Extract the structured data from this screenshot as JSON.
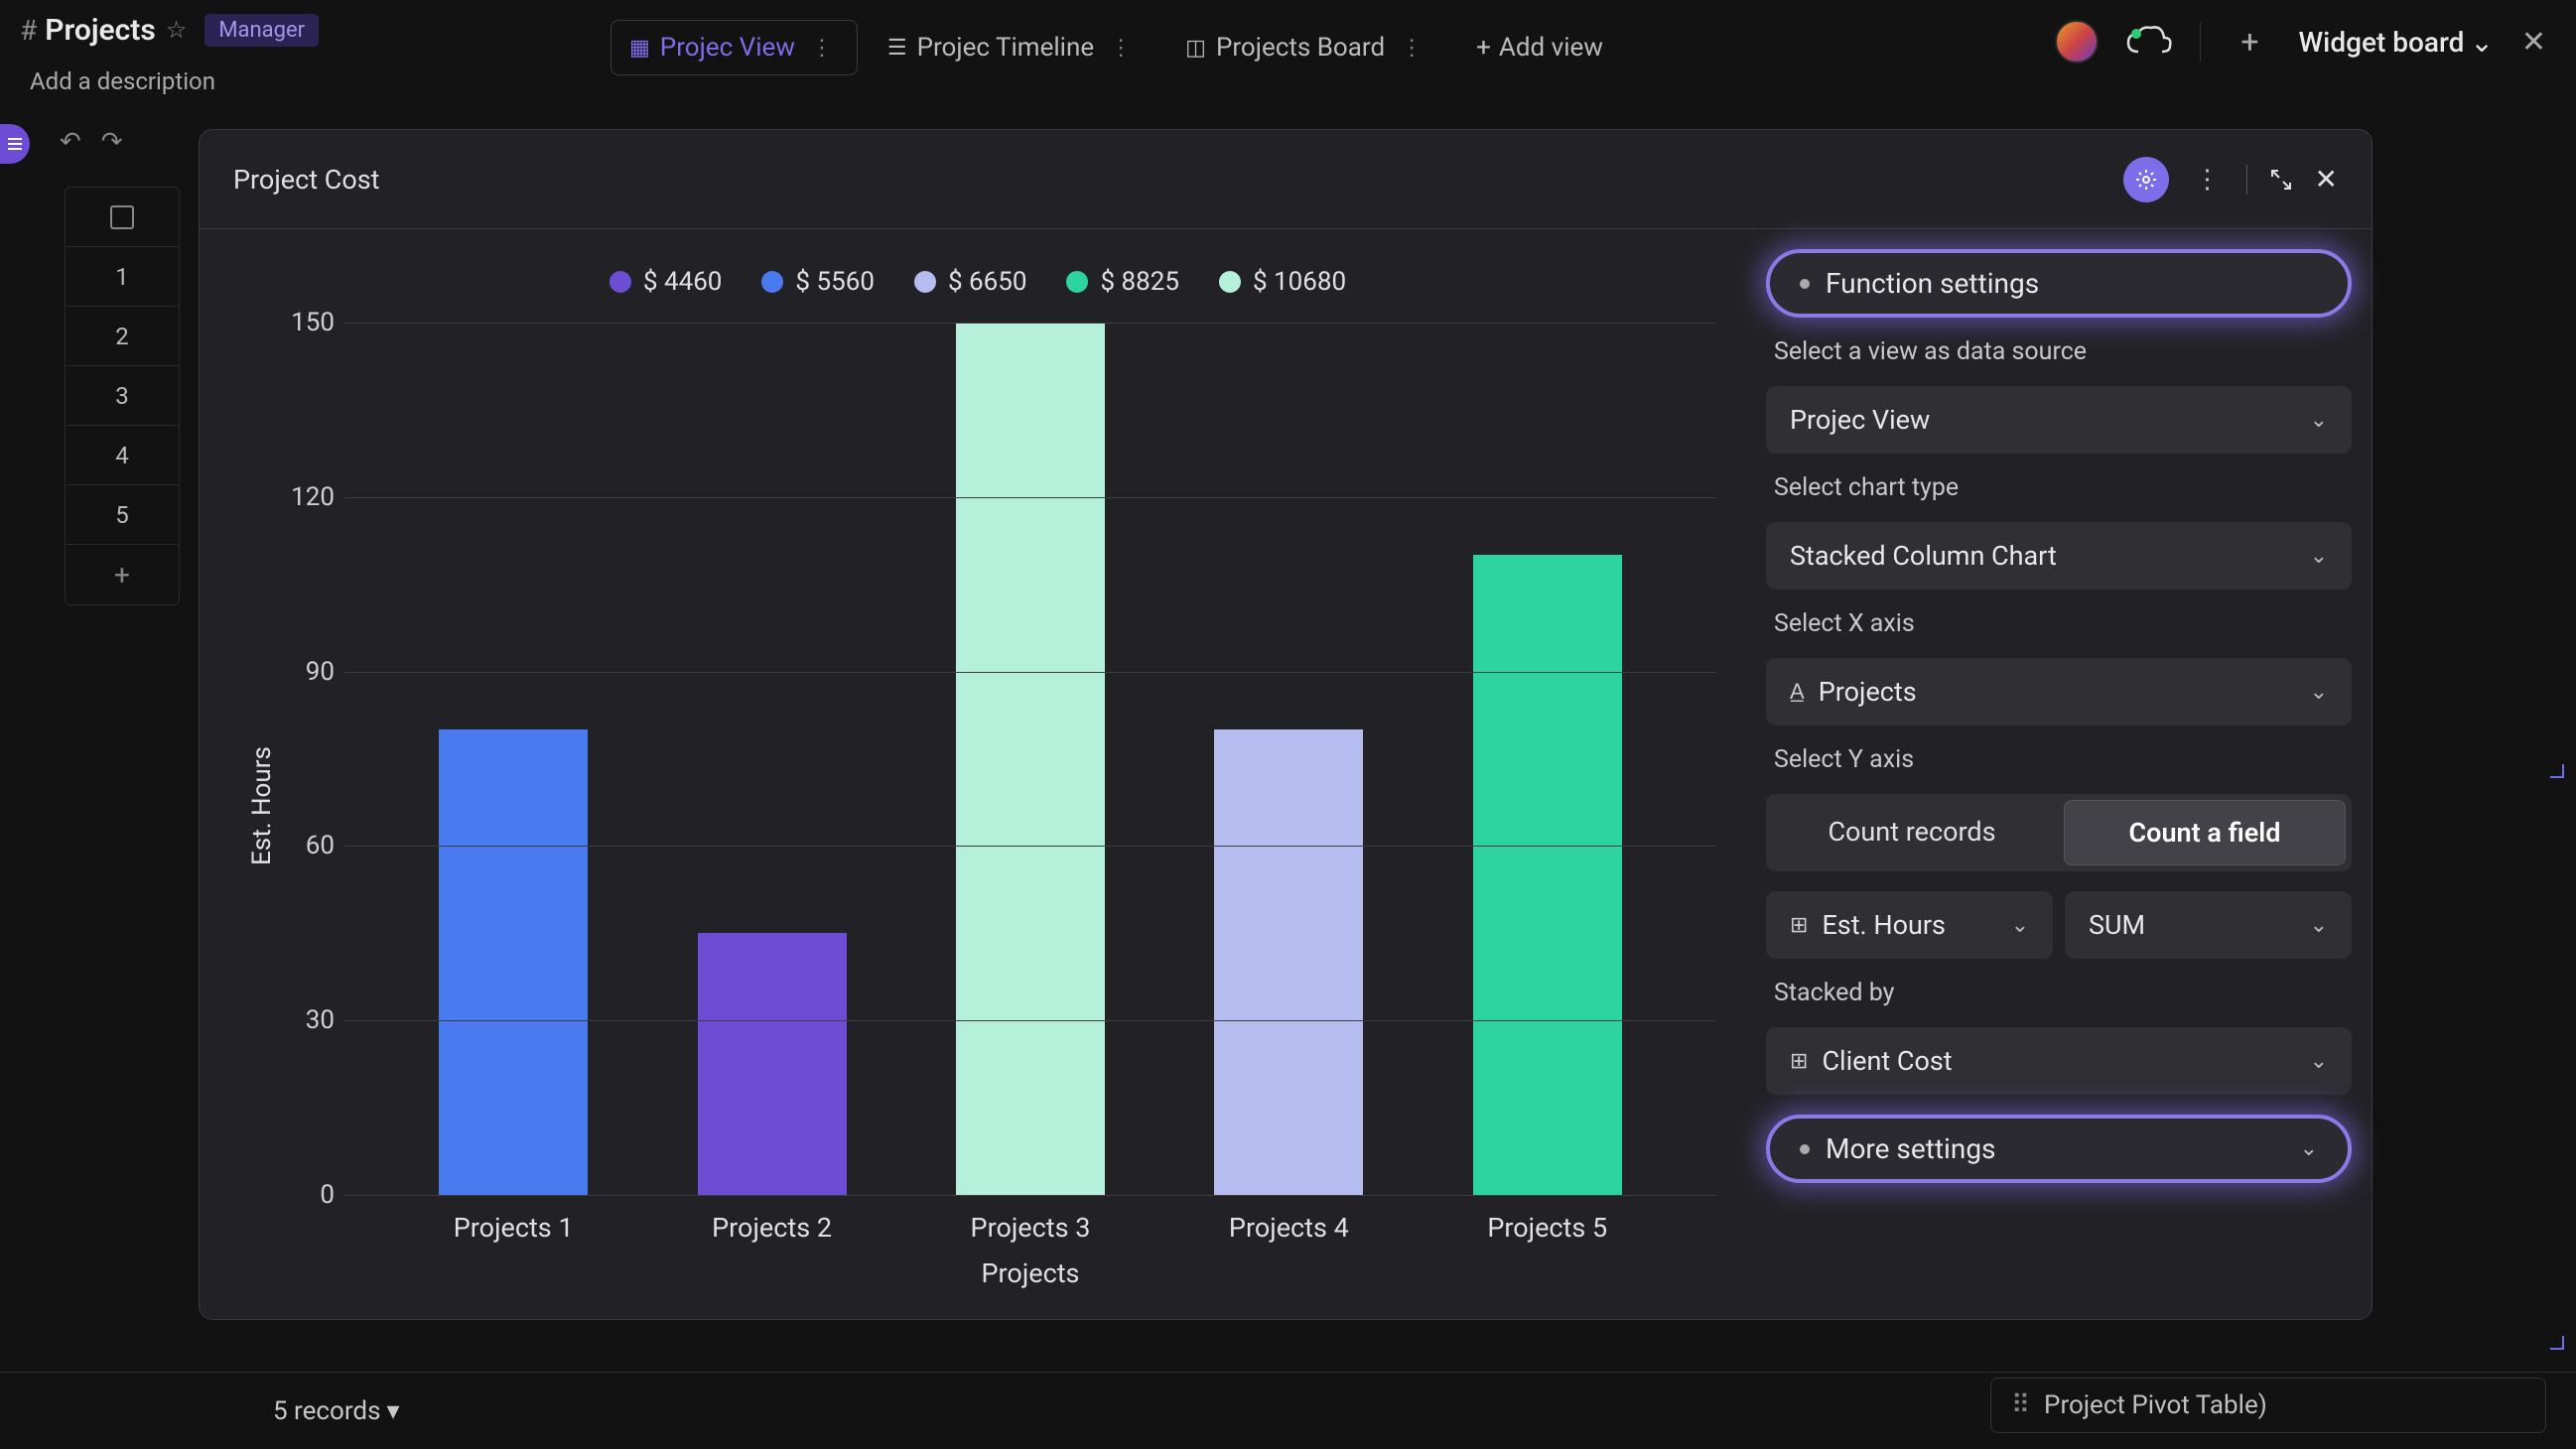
{
  "page": {
    "title": "Projects",
    "badge": "Manager",
    "description_placeholder": "Add a description"
  },
  "views": {
    "tabs": [
      {
        "label": "Projec View",
        "icon": "grid-icon",
        "active": true
      },
      {
        "label": "Projec Timeline",
        "icon": "timeline-icon",
        "active": false
      },
      {
        "label": "Projects Board",
        "icon": "board-icon",
        "active": false
      }
    ],
    "add_view": "Add view"
  },
  "topright": {
    "widget_board": "Widget board"
  },
  "rows": [
    "1",
    "2",
    "3",
    "4",
    "5"
  ],
  "modal": {
    "title": "Project Cost"
  },
  "chart_data": {
    "type": "bar",
    "title": "Project Cost",
    "xlabel": "Projects",
    "ylabel": "Est. Hours",
    "ylim": [
      0,
      150
    ],
    "yticks": [
      0,
      30,
      60,
      90,
      120,
      150
    ],
    "categories": [
      "Projects 1",
      "Projects 2",
      "Projects 3",
      "Projects 4",
      "Projects 5"
    ],
    "values": [
      80,
      45,
      150,
      80,
      110
    ],
    "legend": [
      {
        "label": "$ 4460",
        "color": "#6d4dd4"
      },
      {
        "label": "$ 5560",
        "color": "#4a7af0"
      },
      {
        "label": "$ 6650",
        "color": "#b4bcf0"
      },
      {
        "label": "$ 8825",
        "color": "#2dd4a0"
      },
      {
        "label": "$ 10680",
        "color": "#b4f0da"
      }
    ],
    "bar_colors": [
      "#4a7af0",
      "#6d4dd4",
      "#b4f0da",
      "#b4bcf0",
      "#2dd4a0"
    ]
  },
  "settings": {
    "function_settings": "Function settings",
    "data_source_label": "Select a view as data source",
    "data_source_value": "Projec View",
    "chart_type_label": "Select chart type",
    "chart_type_value": "Stacked Column Chart",
    "x_axis_label": "Select X axis",
    "x_axis_value": "Projects",
    "y_axis_label": "Select Y axis",
    "y_seg": {
      "count_records": "Count records",
      "count_field": "Count a field"
    },
    "y_field_value": "Est. Hours",
    "y_agg_value": "SUM",
    "stacked_by_label": "Stacked by",
    "stacked_by_value": "Client Cost",
    "more_settings": "More settings"
  },
  "status": {
    "records": "5 records",
    "pivot": "Project Pivot Table)"
  }
}
